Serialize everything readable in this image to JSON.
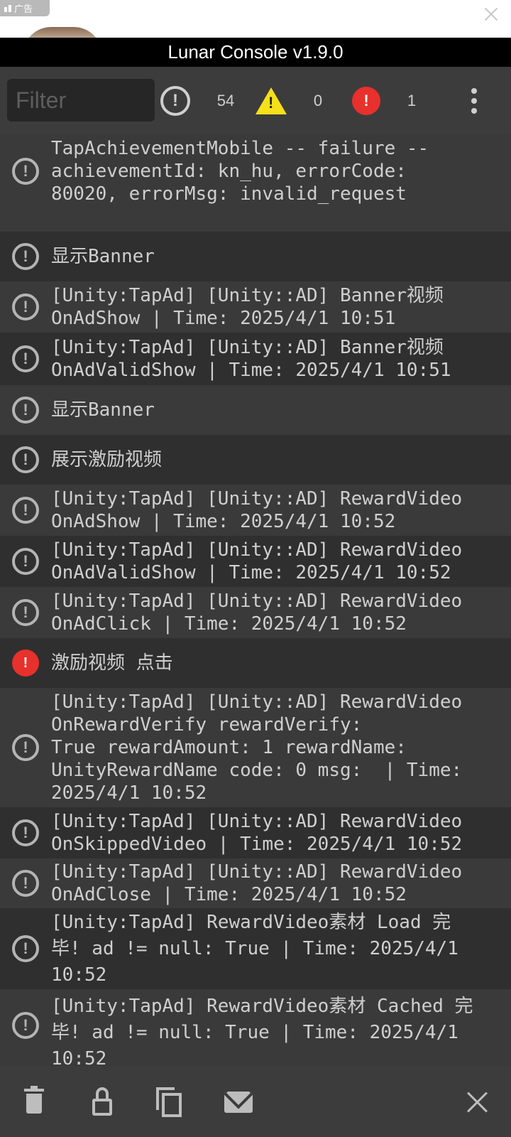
{
  "ad": {
    "badge_label": "广告"
  },
  "console": {
    "title": "Lunar Console v1.9.0"
  },
  "toolbar": {
    "filter_placeholder": "Filter",
    "info_count": "54",
    "warning_count": "0",
    "error_count": "1"
  },
  "icons": {
    "info": "info-circle-icon",
    "warning": "warning-triangle-icon",
    "error": "error-circle-icon",
    "menu": "more-vertical-icon",
    "trash": "trash-icon",
    "lock": "lock-icon",
    "copy": "copy-icon",
    "mail": "mail-icon",
    "close": "close-icon"
  },
  "colors": {
    "error": "#e8302c",
    "warning": "#f6e01a",
    "background": "#2b2b2b"
  },
  "logs": [
    {
      "level": "info",
      "text": "TapAchievementMobile -- failure --\nachievementId: kn_hu, errorCode:\n80020, errorMsg: invalid_request"
    },
    {
      "level": "info",
      "text": "显示Banner"
    },
    {
      "level": "info",
      "text": "[Unity:TapAd] [Unity::AD] Banner视频\nOnAdShow | Time: 2025/4/1 10:51"
    },
    {
      "level": "info",
      "text": "[Unity:TapAd] [Unity::AD] Banner视频\nOnAdValidShow | Time: 2025/4/1 10:51"
    },
    {
      "level": "info",
      "text": "显示Banner"
    },
    {
      "level": "info",
      "text": "展示激励视频"
    },
    {
      "level": "info",
      "text": "[Unity:TapAd] [Unity::AD] RewardVideo\nOnAdShow | Time: 2025/4/1 10:52"
    },
    {
      "level": "info",
      "text": "[Unity:TapAd] [Unity::AD] RewardVideo\nOnAdValidShow | Time: 2025/4/1 10:52"
    },
    {
      "level": "info",
      "text": "[Unity:TapAd] [Unity::AD] RewardVideo\nOnAdClick | Time: 2025/4/1 10:52"
    },
    {
      "level": "error",
      "text": "激励视频 点击"
    },
    {
      "level": "info",
      "text": "[Unity:TapAd] [Unity::AD] RewardVideo\nOnRewardVerify rewardVerify:\nTrue rewardAmount: 1 rewardName:\nUnityRewardName code: 0 msg:  | Time:\n2025/4/1 10:52"
    },
    {
      "level": "info",
      "text": "[Unity:TapAd] [Unity::AD] RewardVideo\nOnSkippedVideo | Time: 2025/4/1 10:52"
    },
    {
      "level": "info",
      "text": "[Unity:TapAd] [Unity::AD] RewardVideo\nOnAdClose | Time: 2025/4/1 10:52"
    },
    {
      "level": "info",
      "text": "[Unity:TapAd] RewardVideo素材 Load 完\n毕! ad != null: True | Time: 2025/4/1\n10:52"
    },
    {
      "level": "info",
      "text": "[Unity:TapAd] RewardVideo素材 Cached 完\n毕! ad != null: True | Time: 2025/4/1\n10:52"
    }
  ]
}
